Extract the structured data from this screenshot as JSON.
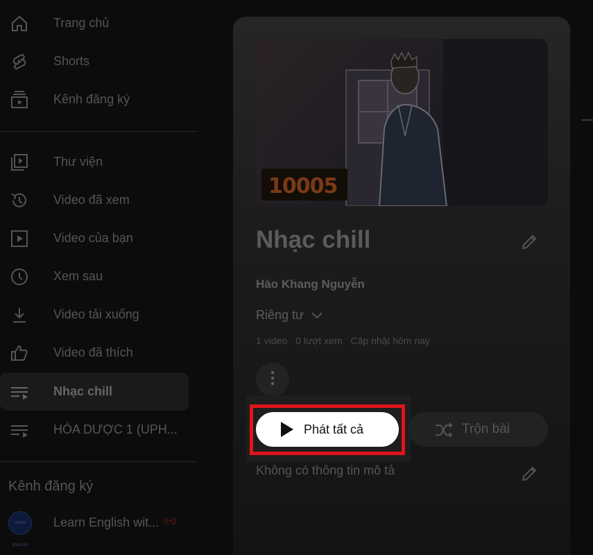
{
  "sidebar": {
    "items": [
      {
        "label": "Trang chủ",
        "icon": "home-icon"
      },
      {
        "label": "Shorts",
        "icon": "shorts-icon"
      },
      {
        "label": "Kênh đăng ký",
        "icon": "subscriptions-icon"
      },
      {
        "label": "Thư viện",
        "icon": "library-icon"
      },
      {
        "label": "Video đã xem",
        "icon": "history-icon"
      },
      {
        "label": "Video của bạn",
        "icon": "your-videos-icon"
      },
      {
        "label": "Xem sau",
        "icon": "watch-later-icon"
      },
      {
        "label": "Video tải xuống",
        "icon": "download-icon"
      },
      {
        "label": "Video đã thích",
        "icon": "like-icon"
      },
      {
        "label": "Nhạc chill",
        "icon": "playlist-icon"
      },
      {
        "label": "HÓA DƯỢC 1 (UPH...",
        "icon": "playlist-icon"
      }
    ],
    "subscriptions_title": "Kênh đăng ký",
    "subscriptions": [
      {
        "label": "Learn English wit...",
        "live": "((•))",
        "avatar_text": "LEARN ENGLISH"
      }
    ]
  },
  "playlist": {
    "thumb_logo_text": "10005",
    "title": "Nhạc chill",
    "owner": "Hào Khang Nguyễn",
    "privacy": "Riêng tư",
    "stats": {
      "videos": "1 video",
      "views": "0 lượt xem",
      "updated": "Cập nhật hôm nay"
    },
    "play_all_label": "Phát tất cả",
    "shuffle_label": "Trộn bài",
    "description": "Không có thông tin mô tả"
  },
  "colors": {
    "highlight": "#e0151b",
    "play_button_bg": "#ffffff"
  }
}
